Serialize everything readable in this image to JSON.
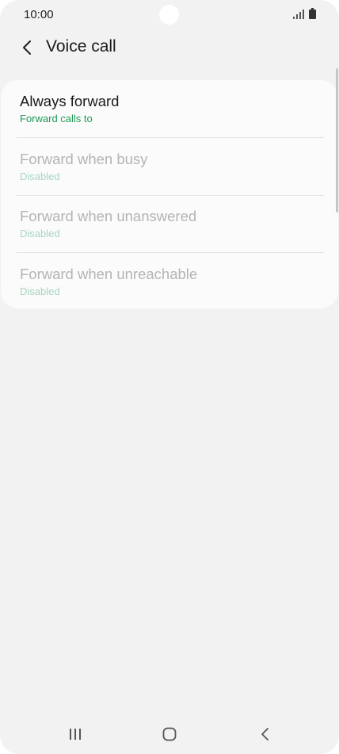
{
  "status_bar": {
    "time": "10:00"
  },
  "header": {
    "title": "Voice call",
    "back_icon": "chevron-left-icon"
  },
  "forwarding_options": [
    {
      "title": "Always forward",
      "subtitle": "Forward calls to",
      "enabled": true
    },
    {
      "title": "Forward when busy",
      "subtitle": "Disabled",
      "enabled": false
    },
    {
      "title": "Forward when unanswered",
      "subtitle": "Disabled",
      "enabled": false
    },
    {
      "title": "Forward when unreachable",
      "subtitle": "Disabled",
      "enabled": false
    }
  ],
  "nav_bar": {
    "recents_icon": "recent-apps-icon",
    "home_icon": "home-icon",
    "back_icon": "back-icon"
  },
  "colors": {
    "background": "#f2f2f2",
    "card": "#fbfbfb",
    "accent_green": "#1f9a57",
    "disabled_text": "#b4b4b4"
  }
}
